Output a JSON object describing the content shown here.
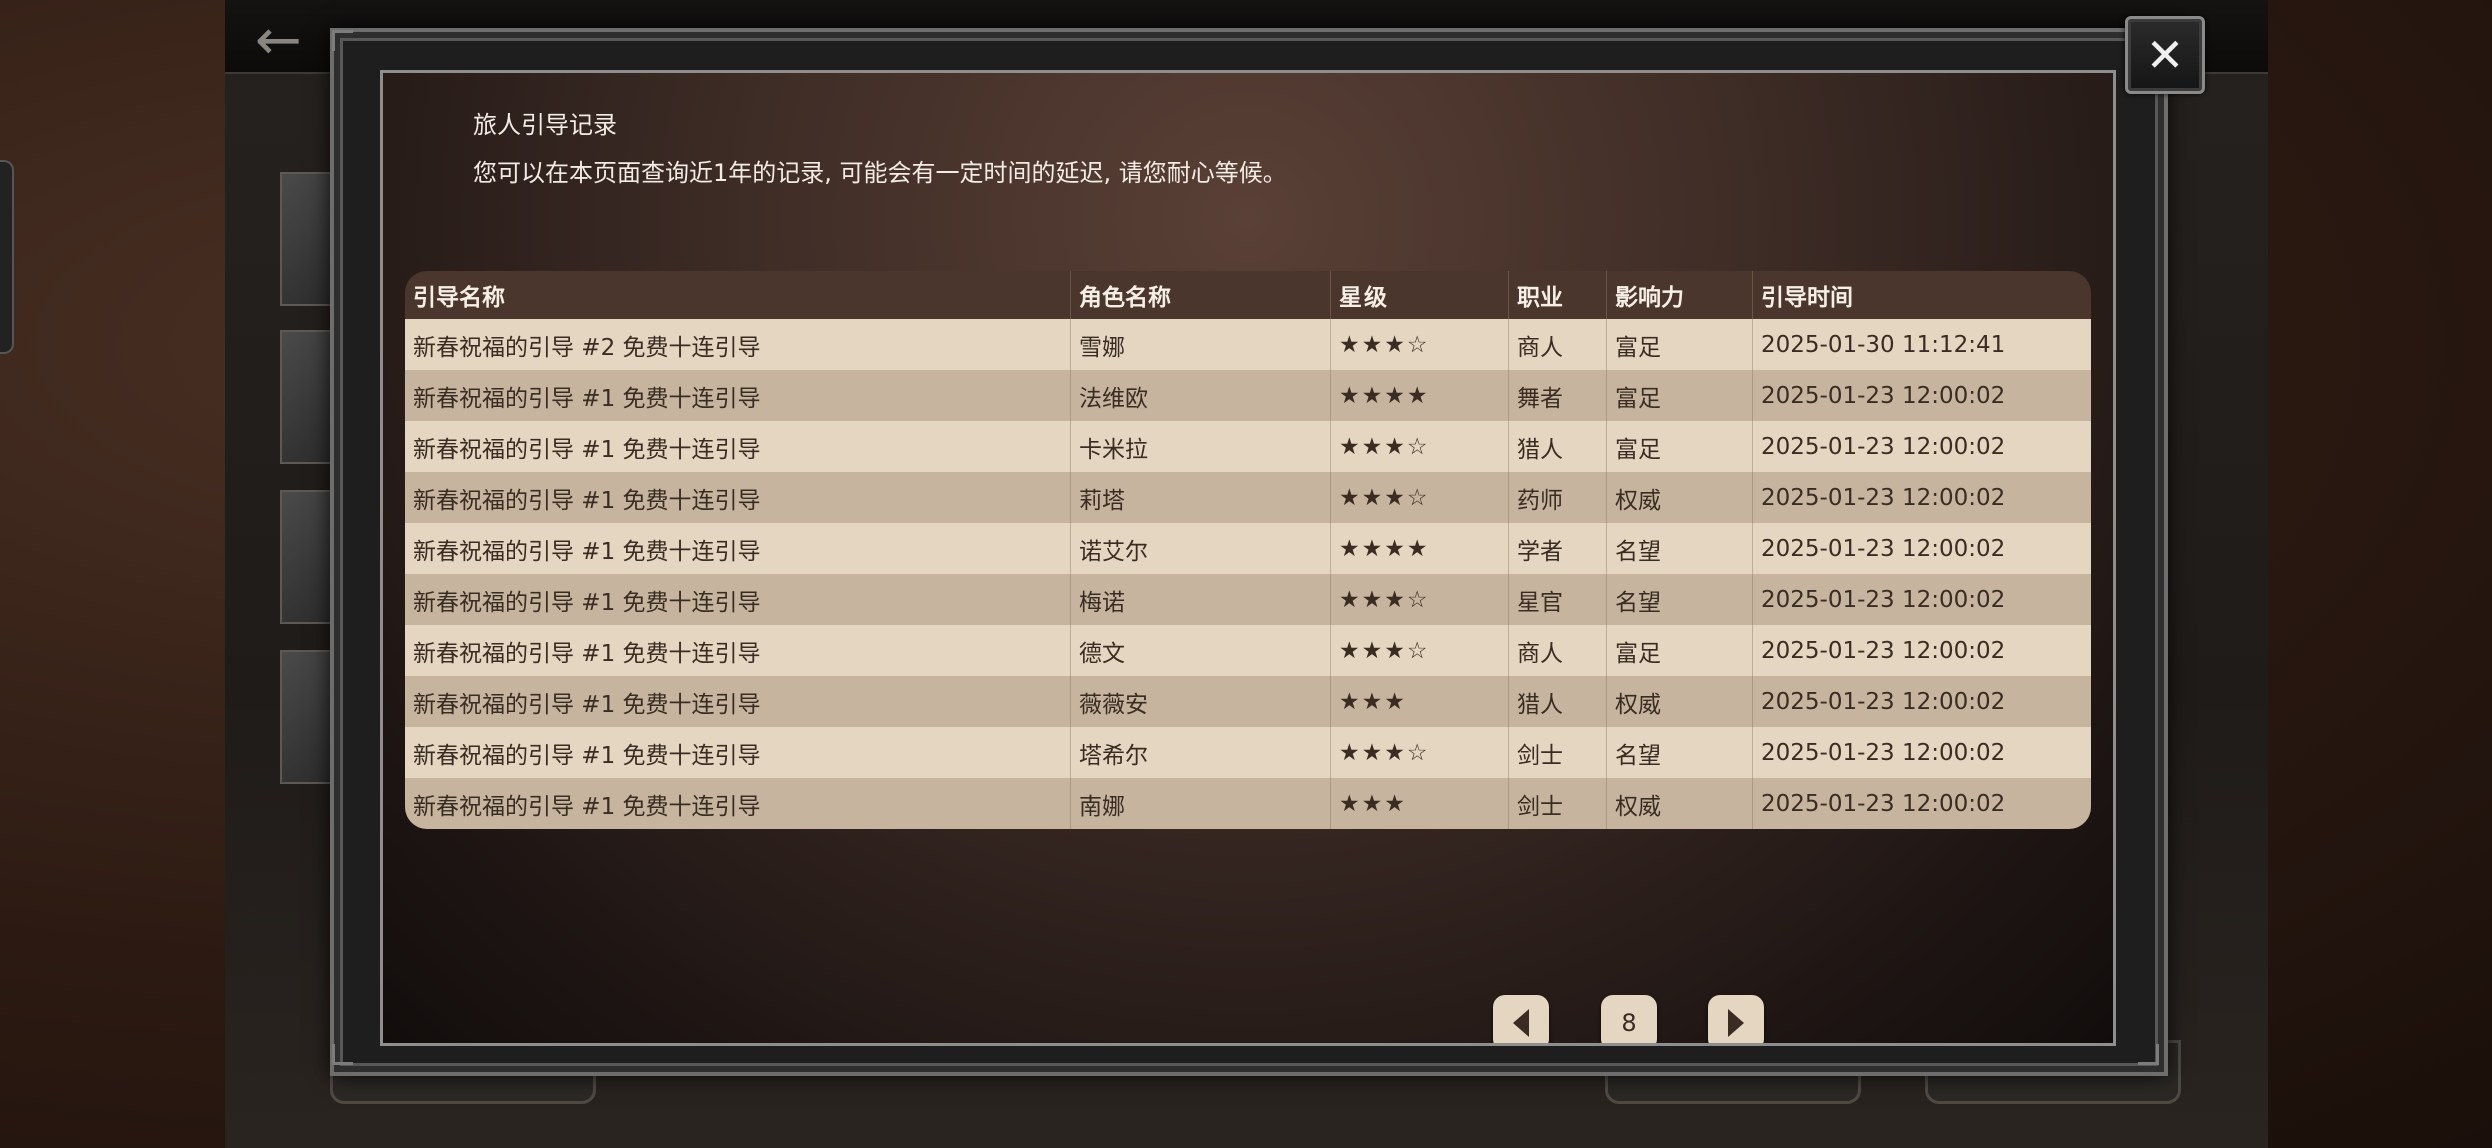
{
  "dialog": {
    "title": "旅人引导记录",
    "subtitle": "您可以在本页面查询近1年的记录, 可能会有一定时间的延迟, 请您耐心等候。"
  },
  "table": {
    "headers": [
      "引导名称",
      "角色名称",
      "星级",
      "职业",
      "影响力",
      "引导时间"
    ],
    "rows": [
      [
        "新春祝福的引导 #2 免费十连引导",
        "雪娜",
        "★★★☆",
        "商人",
        "富足",
        "2025-01-30 11:12:41"
      ],
      [
        "新春祝福的引导 #1 免费十连引导",
        "法维欧",
        "★★★★",
        "舞者",
        "富足",
        "2025-01-23 12:00:02"
      ],
      [
        "新春祝福的引导 #1 免费十连引导",
        "卡米拉",
        "★★★☆",
        "猎人",
        "富足",
        "2025-01-23 12:00:02"
      ],
      [
        "新春祝福的引导 #1 免费十连引导",
        "莉塔",
        "★★★☆",
        "药师",
        "权威",
        "2025-01-23 12:00:02"
      ],
      [
        "新春祝福的引导 #1 免费十连引导",
        "诺艾尔",
        "★★★★",
        "学者",
        "名望",
        "2025-01-23 12:00:02"
      ],
      [
        "新春祝福的引导 #1 免费十连引导",
        "梅诺",
        "★★★☆",
        "星官",
        "名望",
        "2025-01-23 12:00:02"
      ],
      [
        "新春祝福的引导 #1 免费十连引导",
        "德文",
        "★★★☆",
        "商人",
        "富足",
        "2025-01-23 12:00:02"
      ],
      [
        "新春祝福的引导 #1 免费十连引导",
        "薇薇安",
        "★★★",
        "猎人",
        "权威",
        "2025-01-23 12:00:02"
      ],
      [
        "新春祝福的引导 #1 免费十连引导",
        "塔希尔",
        "★★★☆",
        "剑士",
        "名望",
        "2025-01-23 12:00:02"
      ],
      [
        "新春祝福的引导 #1 免费十连引导",
        "南娜",
        "★★★",
        "剑士",
        "权威",
        "2025-01-23 12:00:02"
      ]
    ]
  },
  "pagination": {
    "current_page": "8",
    "prev_icon": "triangle-left-icon",
    "next_icon": "triangle-right-icon"
  },
  "close_icon": "close-x-icon",
  "colors": {
    "header_bg": "#4a362c",
    "row_light": "#e4d6c1",
    "row_dark": "#c6b49e",
    "text_light": "#f2ece4",
    "text_dark": "#3a2c22"
  }
}
